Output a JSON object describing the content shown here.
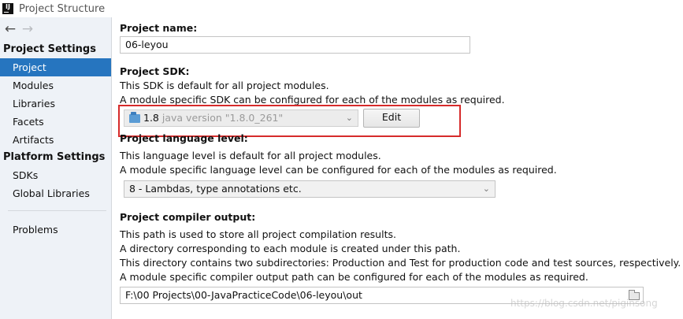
{
  "window": {
    "title": "Project Structure",
    "logo_text": "IJ"
  },
  "nav": {
    "back_symbol": "←",
    "forward_symbol": "→"
  },
  "sidebar": {
    "project_settings_header": "Project Settings",
    "project_settings_items": [
      {
        "label": "Project",
        "selected": true
      },
      {
        "label": "Modules",
        "selected": false
      },
      {
        "label": "Libraries",
        "selected": false
      },
      {
        "label": "Facets",
        "selected": false
      },
      {
        "label": "Artifacts",
        "selected": false
      }
    ],
    "platform_settings_header": "Platform Settings",
    "platform_settings_items": [
      {
        "label": "SDKs"
      },
      {
        "label": "Global Libraries"
      }
    ],
    "problems_label": "Problems"
  },
  "project_name": {
    "label": "Project name:",
    "value": "06-leyou"
  },
  "project_sdk": {
    "label": "Project SDK:",
    "desc1": "This SDK is default for all project modules.",
    "desc2": "A module specific SDK can be configured for each of the modules as required.",
    "sdk_version": "1.8",
    "sdk_description": "java version \"1.8.0_261\"",
    "edit_button": "Edit",
    "highlight_color": "#d62b2b"
  },
  "language_level": {
    "label": "Project language level:",
    "desc1": "This language level is default for all project modules.",
    "desc2": "A module specific language level can be configured for each of the modules as required.",
    "selected": "8 - Lambdas, type annotations etc."
  },
  "compiler_output": {
    "label": "Project compiler output:",
    "desc1": "This path is used to store all project compilation results.",
    "desc2": "A directory corresponding to each module is created under this path.",
    "desc3": "This directory contains two subdirectories: Production and Test for production code and test sources, respectively.",
    "desc4": "A module specific compiler output path can be configured for each of the modules as required.",
    "path_value": "F:\\00  Projects\\00-JavaPracticeCode\\06-leyou\\out"
  },
  "watermark": "https://blog.csdn.net/piginsong",
  "colors": {
    "sidebar_bg": "#eef2f7",
    "selection": "#2675bf"
  }
}
